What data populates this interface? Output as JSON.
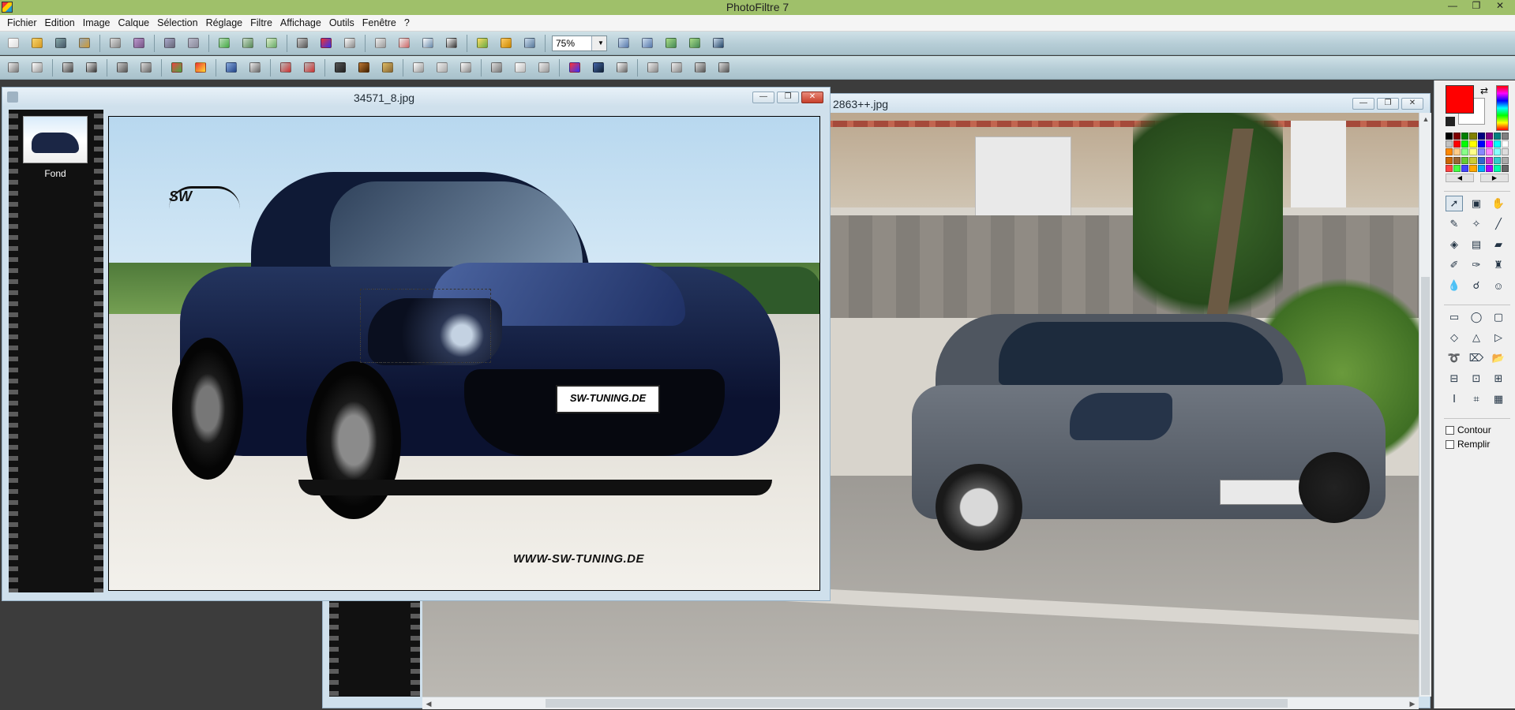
{
  "app": {
    "title": "PhotoFiltre 7"
  },
  "window_controls": {
    "minimize": "—",
    "restore": "❐",
    "close": "✕"
  },
  "menu": [
    "Fichier",
    "Edition",
    "Image",
    "Calque",
    "Sélection",
    "Réglage",
    "Filtre",
    "Affichage",
    "Outils",
    "Fenêtre",
    "?"
  ],
  "toolbar": {
    "zoom_value": "75%"
  },
  "documents": {
    "front": {
      "title": "34571_8.jpg",
      "layer_label": "Fond"
    },
    "back": {
      "title": "2863++.jpg"
    }
  },
  "tools": {
    "contour_label": "Contour",
    "fill_label": "Remplir"
  },
  "colors": {
    "foreground": "#ff0000",
    "background": "#ffffff",
    "title_bar": "#9fc06a"
  }
}
